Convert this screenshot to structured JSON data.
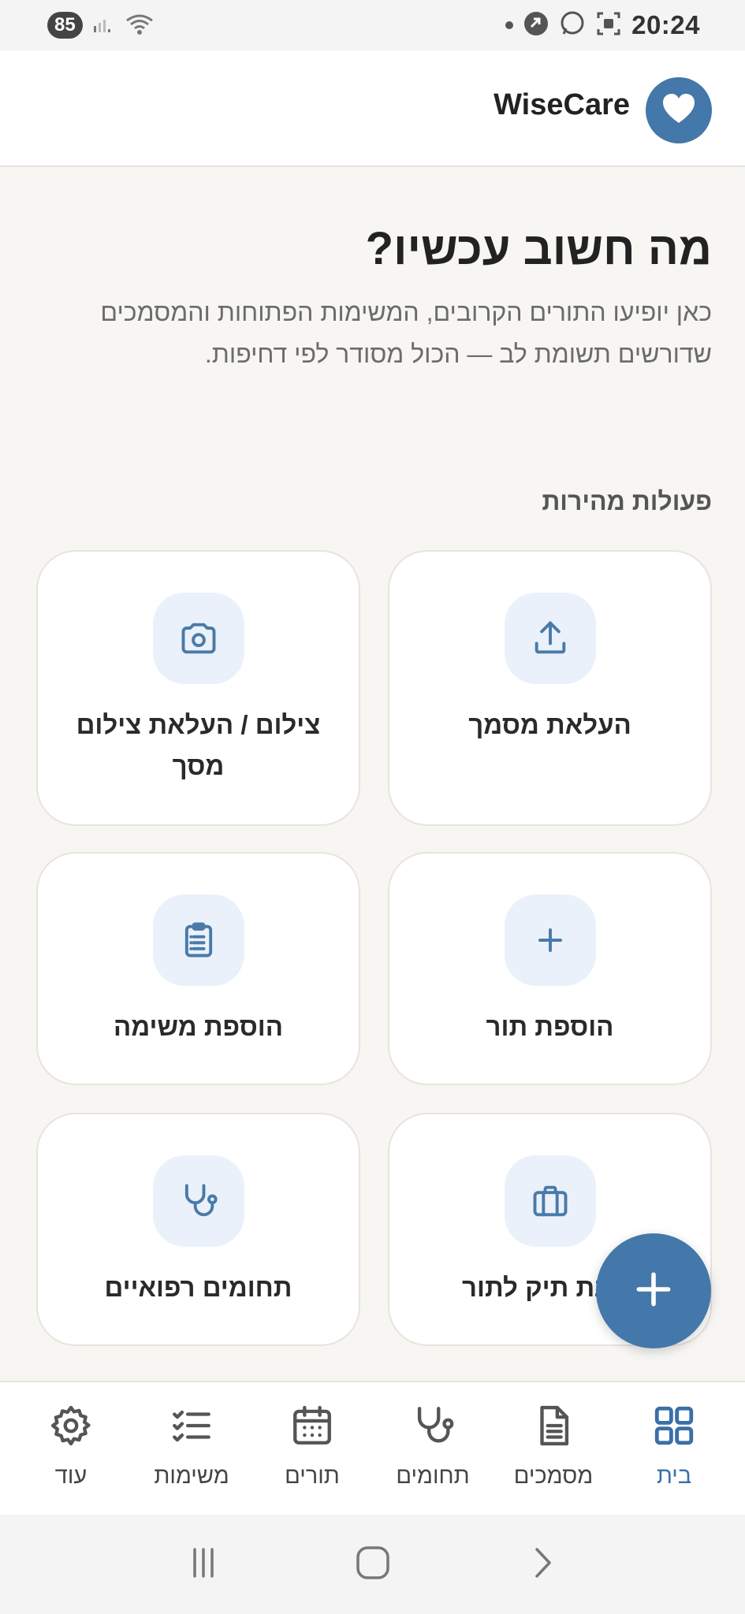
{
  "status_bar": {
    "battery": "85",
    "time": "20:24"
  },
  "header": {
    "app_name": "WiseCare",
    "logo_icon": "heart-icon",
    "brand_color": "#4477aa"
  },
  "intro": {
    "headline": "מה חשוב עכשיו?",
    "subtext": "כאן יופיעו התורים הקרובים, המשימות הפתוחות והמסמכים שדורשים תשומת לב — הכול מסודר לפי דחיפות."
  },
  "quick_actions": {
    "title": "פעולות מהירות",
    "items": [
      {
        "label": "העלאת מסמך",
        "icon": "upload-icon"
      },
      {
        "label": "צילום / העלאת צילום מסך",
        "icon": "camera-icon"
      },
      {
        "label": "הוספת תור",
        "icon": "plus-icon"
      },
      {
        "label": "הוספת משימה",
        "icon": "clipboard-icon"
      },
      {
        "label": "הכנת תיק לתור",
        "icon": "briefcase-icon"
      },
      {
        "label": "תחומים רפואיים",
        "icon": "stethoscope-icon"
      }
    ]
  },
  "fab": {
    "icon": "plus-icon"
  },
  "bottom_nav": {
    "items": [
      {
        "label": "בית",
        "icon": "grid-icon",
        "active": true
      },
      {
        "label": "מסמכים",
        "icon": "document-icon",
        "active": false
      },
      {
        "label": "תחומים",
        "icon": "stethoscope-icon",
        "active": false
      },
      {
        "label": "תורים",
        "icon": "calendar-icon",
        "active": false
      },
      {
        "label": "משימות",
        "icon": "checklist-icon",
        "active": false
      },
      {
        "label": "עוד",
        "icon": "gear-icon",
        "active": false
      }
    ],
    "active_color": "#3b6fa8"
  }
}
